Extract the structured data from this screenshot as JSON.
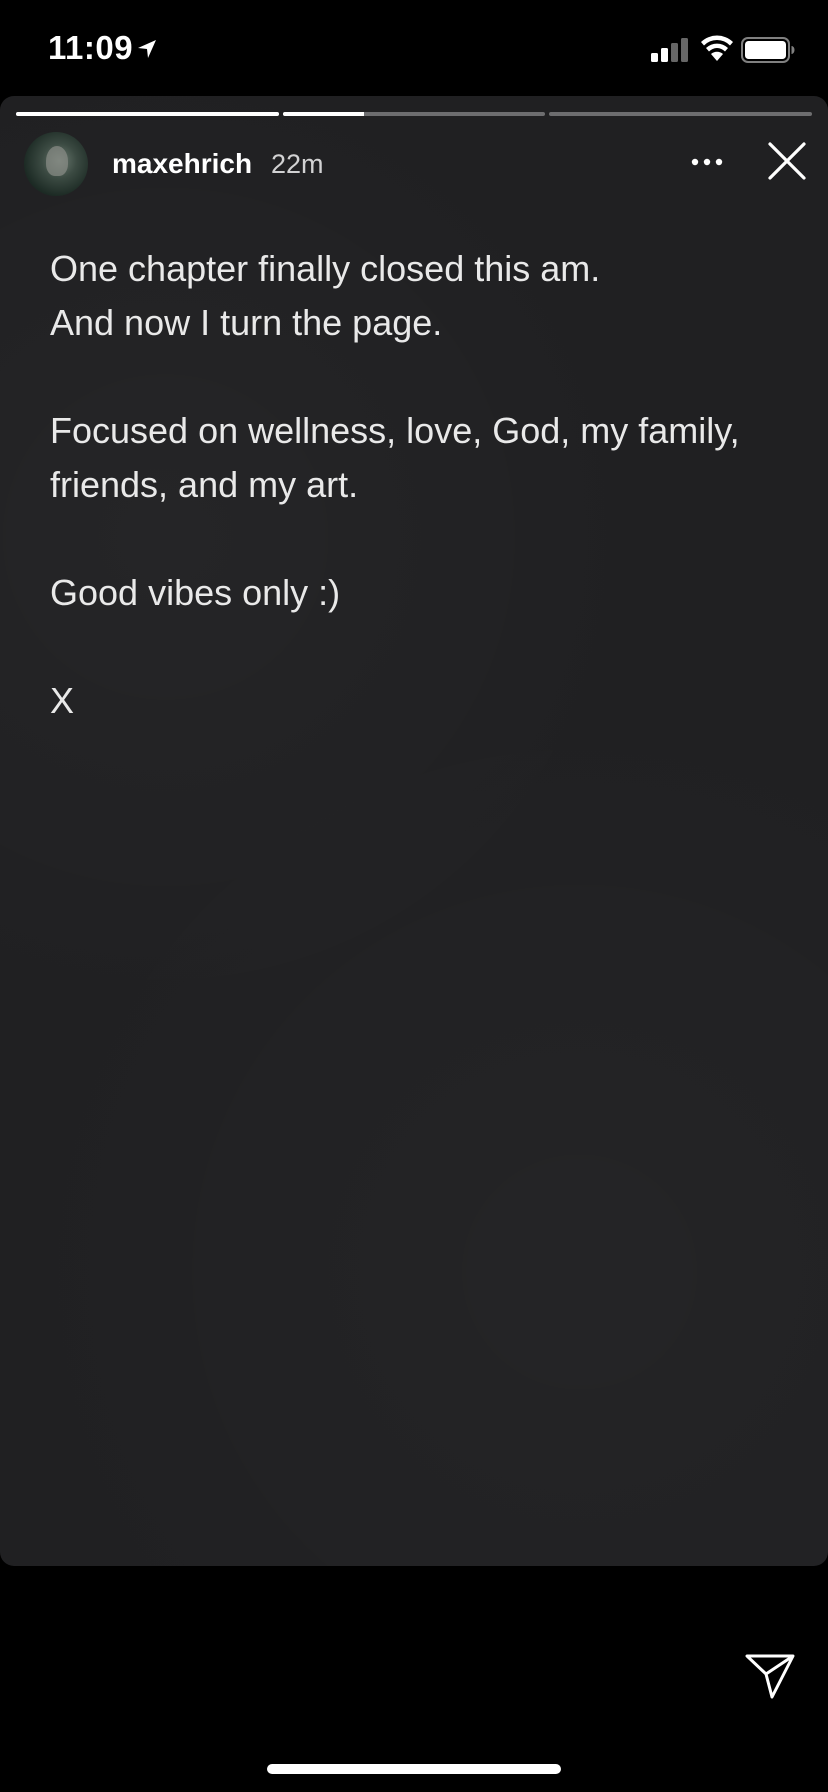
{
  "status_bar": {
    "time": "11:09"
  },
  "story": {
    "progress": [
      1.0,
      0.31,
      0.0
    ],
    "user": {
      "username": "maxehrich",
      "time_ago": "22m"
    },
    "text": {
      "line1": "One chapter finally closed this am.",
      "line2": "And now I turn the page.",
      "line3": "Focused on wellness, love, God, my family,",
      "line4": "friends, and my art.",
      "line5": "Good vibes only :)",
      "line6": "X"
    }
  },
  "icons": {
    "location": "location-arrow-icon",
    "signal": "cellular-signal-icon",
    "wifi": "wifi-icon",
    "battery": "battery-icon",
    "more": "more-dots-icon",
    "close": "close-icon",
    "send": "send-icon"
  }
}
